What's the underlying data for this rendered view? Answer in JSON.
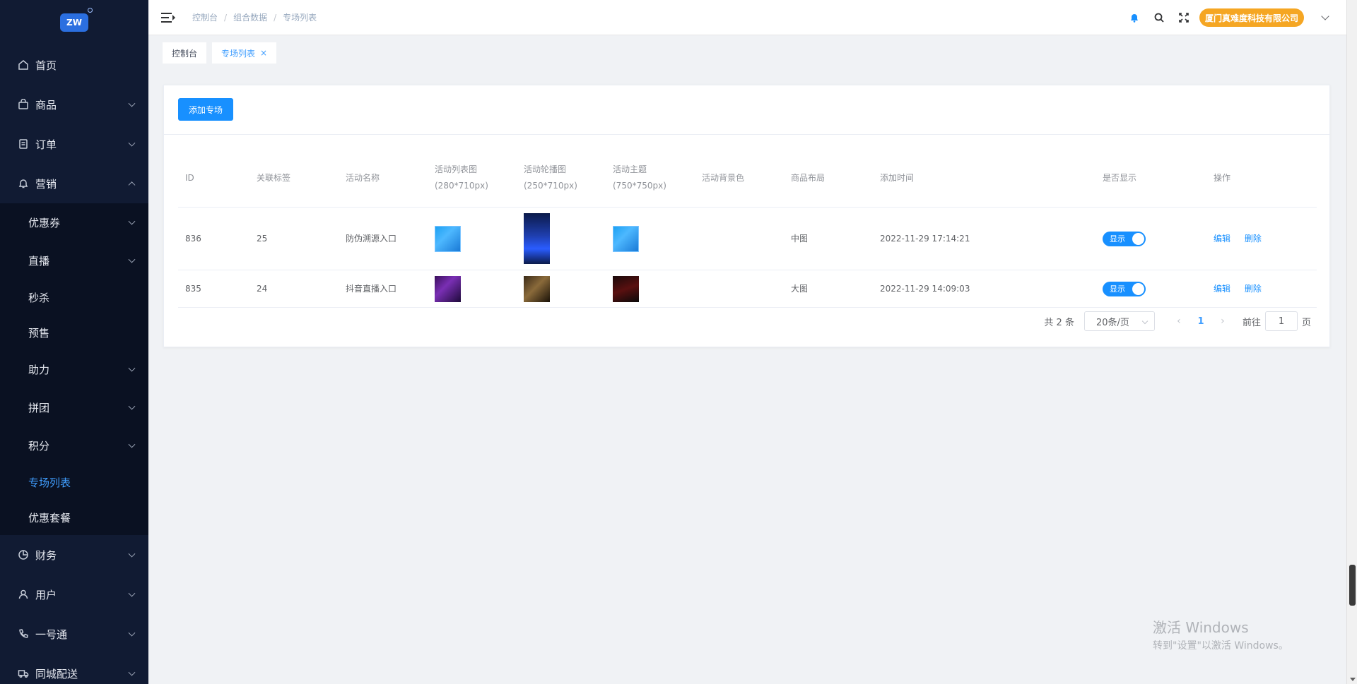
{
  "logo": {
    "text": "ZW"
  },
  "sidebar": {
    "items": [
      {
        "label": "首页",
        "icon": "home-icon"
      },
      {
        "label": "商品",
        "icon": "bag-icon"
      },
      {
        "label": "订单",
        "icon": "document-icon"
      },
      {
        "label": "营销",
        "icon": "bell-icon"
      }
    ],
    "submenu": [
      "优惠券",
      "直播",
      "秒杀",
      "预售",
      "助力",
      "拼团",
      "积分",
      "专场列表",
      "优惠套餐"
    ],
    "bottom_items": [
      {
        "label": "财务",
        "icon": "pie-chart-icon"
      },
      {
        "label": "用户",
        "icon": "user-icon"
      },
      {
        "label": "一号通",
        "icon": "phone-icon"
      },
      {
        "label": "同城配送",
        "icon": "delivery-icon"
      }
    ]
  },
  "header": {
    "breadcrumb": [
      "控制台",
      "组合数据",
      "专场列表"
    ],
    "company": "厦门真难度科技有限公司"
  },
  "tags": [
    {
      "label": "控制台"
    },
    {
      "label": "专场列表",
      "close": "×"
    }
  ],
  "toolbar": {
    "add_label": "添加专场"
  },
  "table": {
    "headers": [
      "ID",
      "关联标签",
      "活动名称",
      "活动列表图(280*710px)",
      "活动轮播图(250*710px)",
      "活动主题(750*750px)",
      "活动背景色",
      "商品布局",
      "添加时间",
      "是否显示",
      "操作"
    ],
    "rows": [
      {
        "id": "836",
        "tag": "25",
        "name": "防伪溯源入口",
        "color": "",
        "layout": "中图",
        "time": "2022-11-29 17:14:21",
        "show": "显示",
        "edit": "编辑",
        "delete": "删除"
      },
      {
        "id": "835",
        "tag": "24",
        "name": "抖音直播入口",
        "color": "",
        "layout": "大图",
        "time": "2022-11-29 14:09:03",
        "show": "显示",
        "edit": "编辑",
        "delete": "删除"
      }
    ]
  },
  "pagination": {
    "total": "共 2 条",
    "page_size": "20条/页",
    "current": "1",
    "goto_prefix": "前往",
    "goto_value": "1",
    "goto_suffix": "页",
    "prev": "‹",
    "next": "›"
  },
  "watermark": {
    "title": "激活 Windows",
    "subtitle": "转到\"设置\"以激活 Windows。"
  },
  "colors": {
    "sidebar_bg": "#111b33",
    "accent": "#1890ff",
    "company_badge": "#f5a623"
  }
}
